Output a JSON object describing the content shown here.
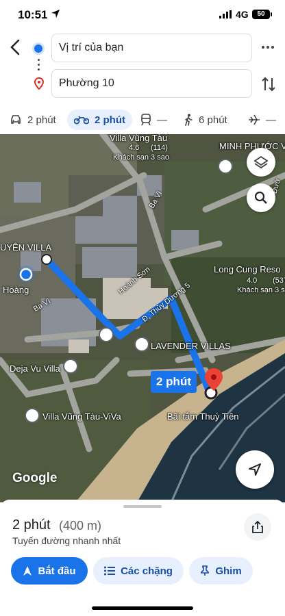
{
  "status_bar": {
    "time": "10:51",
    "network": "4G",
    "battery": "50"
  },
  "route_inputs": {
    "origin": "Vị trí của bạn",
    "destination": "Phường 10"
  },
  "modes": [
    {
      "icon": "car-icon",
      "label": "2 phút"
    },
    {
      "icon": "motorbike-icon",
      "label": "2 phút",
      "active": true
    },
    {
      "icon": "transit-icon",
      "label": "—"
    },
    {
      "icon": "walk-icon",
      "label": "6 phút"
    },
    {
      "icon": "flight-icon",
      "label": "—"
    }
  ],
  "map": {
    "labels": {
      "villa_vung_tau": "Villa Vũng Tàu",
      "rating_1": "4.6",
      "count_1": "(114)",
      "hotel_1": "Khách sạn 3 sao",
      "minh_phuoc": "MINH PHƯỚC V",
      "uyen_villa": "UYÊN VILLA",
      "hoang": "Hoàng",
      "ba_vi_1": "Ba Vì",
      "ba_vi_2": "Ba Vì",
      "hoanh_son": "Hoành Sơn",
      "thuy_duong": "Đ. Thùy Dương 5",
      "long_cung": "Long Cung Reso",
      "rating_2": "4.0",
      "count_2": "(537",
      "hotel_2": "Khách sạn 3 sa",
      "lavender": "LAVENDER VILLAS",
      "deja_vu": "Deja Vu Villa",
      "villa_viva": "Villa Vũng Tàu-ViVa",
      "bai_tam": "Bãi tắm Thuỳ Tiên",
      "duong": "Đườ"
    },
    "eta_badge": "2 phút",
    "attribution": "Google",
    "route_color": "#1a73e8"
  },
  "sheet": {
    "duration": "2 phút",
    "distance": "(400 m)",
    "subtitle": "Tuyến đường nhanh nhất",
    "buttons": {
      "start": "Bắt đầu",
      "steps": "Các chặng",
      "pin": "Ghim"
    }
  }
}
